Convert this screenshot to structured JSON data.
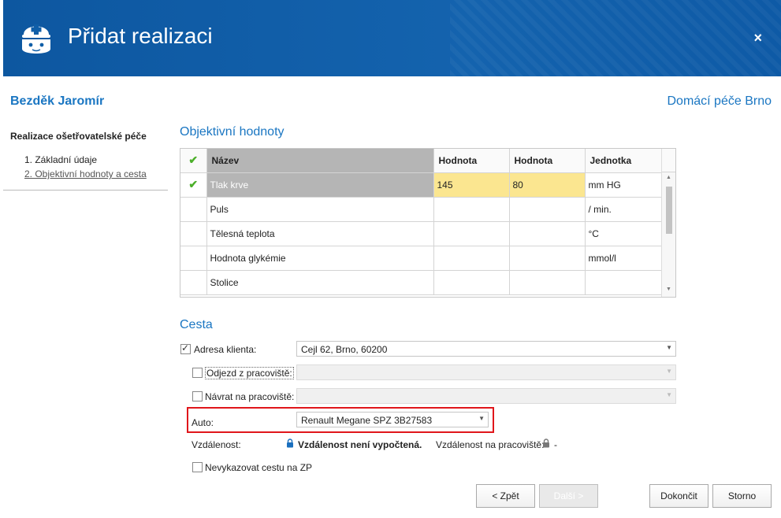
{
  "window": {
    "title": "Přidat realizaci",
    "close_label": "×"
  },
  "patient_name": "Bezděk Jaromír",
  "organization": "Domácí péče Brno",
  "sidebar": {
    "title": "Realizace ošetřovatelské péče",
    "items": [
      {
        "label": "1. Základní údaje"
      },
      {
        "label": "2. Objektivní hodnoty a cesta"
      }
    ]
  },
  "objective": {
    "heading": "Objektivní hodnoty",
    "columns": [
      "Název",
      "Hodnota",
      "Hodnota",
      "Jednotka"
    ],
    "rows": [
      {
        "name": "Tlak krve",
        "v1": "145",
        "v2": "80",
        "unit": "mm HG",
        "checked": true,
        "selected": true
      },
      {
        "name": "Puls",
        "v1": "",
        "v2": "",
        "unit": "/ min.",
        "checked": false,
        "selected": false
      },
      {
        "name": "Tělesná teplota",
        "v1": "",
        "v2": "",
        "unit": "°C",
        "checked": false,
        "selected": false
      },
      {
        "name": "Hodnota glykémie",
        "v1": "",
        "v2": "",
        "unit": "mmol/l",
        "checked": false,
        "selected": false
      },
      {
        "name": "Stolice",
        "v1": "",
        "v2": "",
        "unit": "",
        "checked": false,
        "selected": false
      }
    ]
  },
  "route": {
    "heading": "Cesta",
    "client_address_label": "Adresa klienta:",
    "client_address_value": "Cejl 62, Brno, 60200",
    "client_address_checked": true,
    "departure_label": "Odjezd z pracoviště:",
    "departure_value": "",
    "return_label": "Návrat na pracoviště:",
    "return_value": "",
    "car_label": "Auto:",
    "car_value": "Renault Megane SPZ 3B27583",
    "distance_label": "Vzdálenost:",
    "distance_value": "Vzdálenost není vypočtená.",
    "workplace_distance_label": "Vzdálenost na pracoviště:",
    "workplace_distance_value": "-",
    "no_report_label": "Nevykazovat cestu na ZP"
  },
  "buttons": {
    "back": "< Zpět",
    "next": "Další >",
    "finish": "Dokončit",
    "cancel": "Storno"
  }
}
